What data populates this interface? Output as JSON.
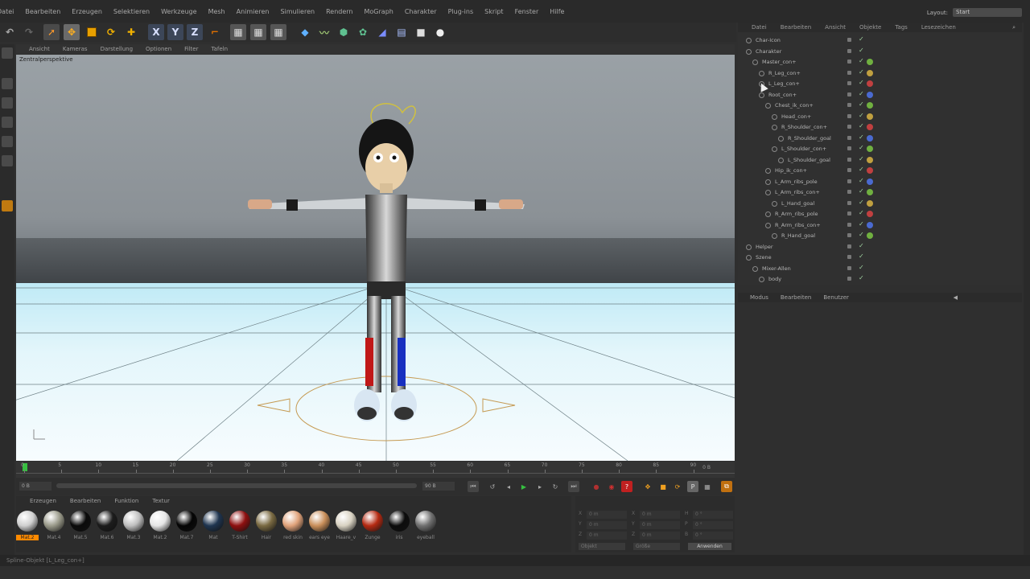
{
  "menubar": {
    "items": [
      "Datei",
      "Bearbeiten",
      "Erzeugen",
      "Selektieren",
      "Werkzeuge",
      "Mesh",
      "Animieren",
      "Simulieren",
      "Rendern",
      "MoGraph",
      "Charakter",
      "Plug-ins",
      "Skript",
      "Fenster",
      "Hilfe"
    ],
    "layout_label": "Layout:",
    "layout_value": "Start"
  },
  "viewport": {
    "menu": [
      "Ansicht",
      "Kameras",
      "Darstellung",
      "Optionen",
      "Filter",
      "Tafeln"
    ],
    "label": "Zentralperspektive"
  },
  "timeline": {
    "ticks": [
      "0",
      "5",
      "10",
      "15",
      "20",
      "25",
      "30",
      "35",
      "40",
      "45",
      "50",
      "55",
      "60",
      "65",
      "70",
      "75",
      "80",
      "85",
      "90"
    ],
    "current": "0 B",
    "start_field": "0 B",
    "end_field": "90 B"
  },
  "materials": {
    "menu": [
      "Erzeugen",
      "Bearbeiten",
      "Funktion",
      "Textur"
    ],
    "items": [
      {
        "label": "Mat.2",
        "color": "#cfcfcf",
        "selected": true
      },
      {
        "label": "Mat.4",
        "color": "#9a9a8a"
      },
      {
        "label": "Mat.5",
        "color": "#0a0a0a"
      },
      {
        "label": "Mat.6",
        "color": "#1c1c1c"
      },
      {
        "label": "Mat.3",
        "color": "#bfbfbf"
      },
      {
        "label": "Mat.2",
        "color": "#e6e6e6"
      },
      {
        "label": "Mat.7",
        "color": "#050505"
      },
      {
        "label": "Mat",
        "color": "#1f3550"
      },
      {
        "label": "T-Shirt",
        "color": "#8e1010"
      },
      {
        "label": "Hair",
        "color": "#7a6a42"
      },
      {
        "label": "red skin",
        "color": "#e0a27a"
      },
      {
        "label": "ears eye",
        "color": "#c98f5a"
      },
      {
        "label": "Haare_v",
        "color": "#d8d2c2"
      },
      {
        "label": "Zunge",
        "color": "#b52a12"
      },
      {
        "label": "iris",
        "color": "#0c0c0c"
      },
      {
        "label": "eyeball",
        "color": "#707070"
      }
    ]
  },
  "coords": {
    "rows": [
      [
        "X",
        "0 m",
        "X",
        "0 m",
        "H",
        "0 °"
      ],
      [
        "Y",
        "0 m",
        "Y",
        "0 m",
        "P",
        "0 °"
      ],
      [
        "Z",
        "0 m",
        "Z",
        "0 m",
        "B",
        "0 °"
      ]
    ],
    "left_select": "Objekt",
    "mid_select": "Größe",
    "apply_label": "Anwenden"
  },
  "object_manager": {
    "menu": [
      "Datei",
      "Bearbeiten",
      "Ansicht",
      "Objekte",
      "Tags",
      "Lesezeichen"
    ],
    "rows": [
      {
        "name": "Char-Icon",
        "indent": 0
      },
      {
        "name": "Charakter",
        "indent": 0
      },
      {
        "name": "Master_con+",
        "indent": 1
      },
      {
        "name": "R_Leg_con+",
        "indent": 2
      },
      {
        "name": "L_Leg_con+",
        "indent": 2
      },
      {
        "name": "Root_con+",
        "indent": 2
      },
      {
        "name": "Chest_ik_con+",
        "indent": 3
      },
      {
        "name": "Head_con+",
        "indent": 4
      },
      {
        "name": "R_Shoulder_con+",
        "indent": 4
      },
      {
        "name": "R_Shoulder_goal",
        "indent": 5
      },
      {
        "name": "L_Shoulder_con+",
        "indent": 4
      },
      {
        "name": "L_Shoulder_goal",
        "indent": 5
      },
      {
        "name": "Hip_ik_con+",
        "indent": 3
      },
      {
        "name": "L_Arm_ribs_pole",
        "indent": 3
      },
      {
        "name": "L_Arm_ribs_con+",
        "indent": 3
      },
      {
        "name": "L_Hand_goal",
        "indent": 4
      },
      {
        "name": "R_Arm_ribs_pole",
        "indent": 3
      },
      {
        "name": "R_Arm_ribs_con+",
        "indent": 3
      },
      {
        "name": "R_Hand_goal",
        "indent": 4
      },
      {
        "name": "Helper",
        "indent": 0
      },
      {
        "name": "Szene",
        "indent": 0
      },
      {
        "name": "Mixer-Allen",
        "indent": 1
      },
      {
        "name": "body",
        "indent": 2
      }
    ]
  },
  "attribute_manager": {
    "menu": [
      "Modus",
      "Bearbeiten",
      "Benutzer"
    ]
  },
  "status": {
    "text": "Spline-Objekt [L_Leg_con+]"
  },
  "colors": {
    "panel": "#2f2f2f",
    "viewport_floor": "#e9f6fa",
    "accent": "#ff8a00",
    "play": "#36c040"
  }
}
